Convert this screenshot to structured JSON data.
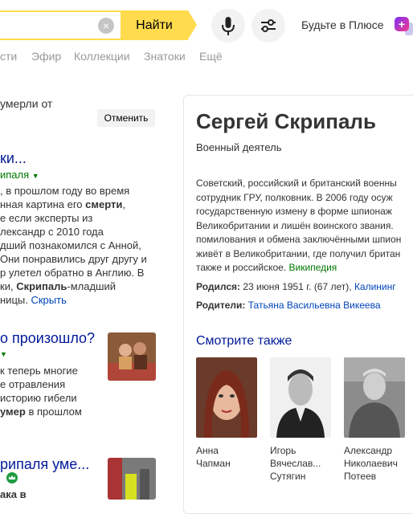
{
  "header": {
    "clear_icon": "×",
    "find_label": "Найти",
    "plus_label": "Будьте в Плюсе",
    "plus_badge": "+"
  },
  "nav": {
    "items": [
      "сти",
      "Эфир",
      "Коллекции",
      "Знатоки",
      "Ещё"
    ]
  },
  "left": {
    "correction_text": "умерли от",
    "cancel_label": "Отменить",
    "result1": {
      "title": "ки...",
      "url": "ипаля",
      "lines": [
        ", в прошлом году во время",
        "нная картина его смерти,",
        "е если эксперты из",
        "лександр с 2010 года",
        "дший познакомился с Анной,",
        "Они понравились друг другу и",
        "р улетел обратно в Англию. В",
        "ки, Скрипаль-младший",
        "ницы."
      ],
      "hide_label": "Скрыть"
    },
    "result2": {
      "title": "о произошло?",
      "lines": [
        "к теперь многие",
        "е отравления",
        "историю гибели",
        "умер в прошлом"
      ]
    },
    "result3": {
      "title": "рипаля уме...",
      "line": "ака в"
    }
  },
  "card": {
    "title": "Сергей Скрипаль",
    "subtitle": "Военный деятель",
    "desc_lines": [
      "Советский, российский и британский военны",
      "сотрудник ГРУ, полковник. В 2006 году осуж",
      "государственную измену в форме шпионаж",
      "Великобритании и лишён воинского звания. ",
      "помилования и обмена заключёнными шпион",
      "живёт в Великобритании, где получил британ",
      "также и российское."
    ],
    "source_label": "Википедия",
    "born_label": "Родился:",
    "born_value": "23 июня 1951 г. (67 лет),",
    "born_place": "Калининг",
    "parents_label": "Родители:",
    "parents_value": "Татьяна Васильевна Викеева",
    "see_also_title": "Смотрите также",
    "people": [
      {
        "name": "Анна\nЧапман"
      },
      {
        "name": "Игорь\nВячеслав...\nСутягин"
      },
      {
        "name": "Александр\nНиколаевич\nПотеев"
      }
    ]
  }
}
